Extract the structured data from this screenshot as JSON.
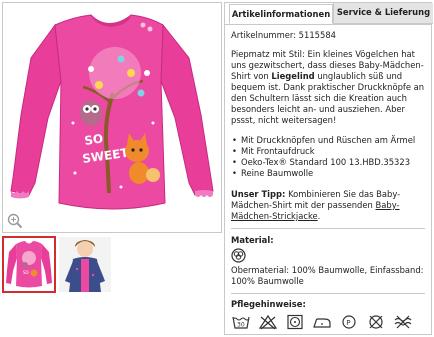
{
  "tabs": [
    {
      "label": "Artikelinformationen"
    },
    {
      "label": "Service & Lieferung"
    }
  ],
  "article": {
    "number": "Artikelnummer: 5115584",
    "desc_part1": "Piepmatz mit Stil: Ein kleines Vögelchen hat uns gezwitschert, dass dieses Baby-Mädchen-Shirt von ",
    "desc_brand": "Liegelind",
    "desc_part2": " unglaublich süß und bequem ist. Dank praktischer Druckknöpfe an den Schultern lässt sich die Kreation auch besonders leicht an- und ausziehen. Aber pssst, nicht weitersagen!",
    "features": [
      "Mit Druckknöpfen und Rüschen am Ärmel",
      "Mit Frontaufdruck",
      "Oeko-Tex® Standard 100 13.HBD.35323",
      "Reine Baumwolle"
    ]
  },
  "tipp": {
    "label": "Unser Tipp:",
    "text": " Kombinieren Sie das Baby-Mädchen-Shirt mit der passenden ",
    "link": "Baby-Mädchen-Strickjacke",
    "end": "."
  },
  "material": {
    "title": "Material:",
    "icon": "cotton-icon",
    "text": "Obermaterial: 100% Baumwolle, Einfassband: 100% Baumwolle"
  },
  "care": {
    "title": "Pflegehinweise:",
    "icons": [
      "wash-30-icon",
      "no-bleach-icon",
      "tumble-dry-icon",
      "iron-icon",
      "no-dry-clean-icon",
      "dry-clean-cross-icon",
      "no-wring-icon"
    ]
  },
  "colors": {
    "border": "#c9c9c9",
    "tab_inactive": "#e4e4e4",
    "thumb_selected": "#d12d2d",
    "shirt": "#e83e9a"
  }
}
